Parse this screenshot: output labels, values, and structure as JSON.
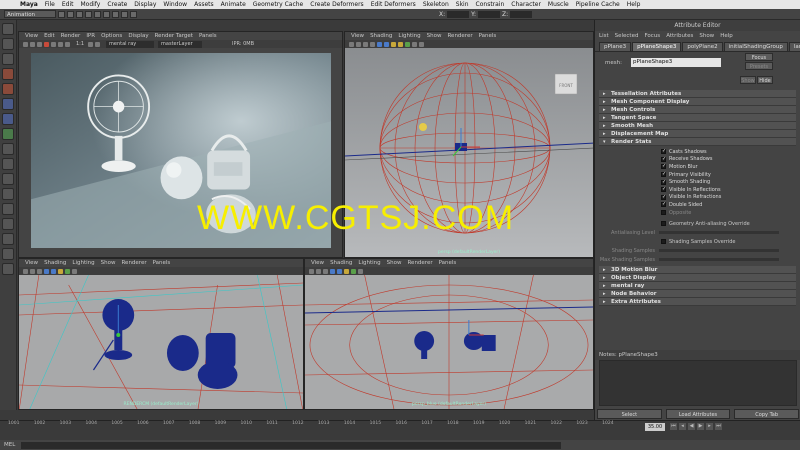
{
  "menubar": {
    "items": [
      "Maya",
      "File",
      "Edit",
      "Modify",
      "Create",
      "Display",
      "Window",
      "Assets",
      "Animate",
      "Geometry Cache",
      "Create Deformers",
      "Edit Deformers",
      "Skeleton",
      "Skin",
      "Constrain",
      "Character",
      "Muscle",
      "Pipeline Cache",
      "Help"
    ]
  },
  "status_line": {
    "mode": "Animation",
    "x_label": "X:",
    "y_label": "Y:",
    "z_label": "Z:"
  },
  "render_view": {
    "menu": [
      "View",
      "Edit",
      "Render",
      "IPR",
      "Options",
      "Display",
      "Render Target",
      "Panels"
    ],
    "ratio": "1:1",
    "renderer": "mental ray",
    "layer": "masterLayer",
    "ipr": "IPR: 0MB"
  },
  "persp_panel": {
    "menu": [
      "View",
      "Shading",
      "Lighting",
      "Show",
      "Renderer",
      "Panels"
    ],
    "label": "persp (defaultRenderLayer)",
    "cube_label": "FRONT"
  },
  "front_panel": {
    "menu": [
      "View",
      "Shading",
      "Lighting",
      "Show",
      "Renderer",
      "Panels"
    ],
    "label": "RENDERCM (defaultRenderLayer)"
  },
  "side_panel": {
    "menu": [
      "View",
      "Shading",
      "Lighting",
      "Show",
      "Renderer",
      "Panels"
    ],
    "label": "persp_blue (defaultRenderLayer)"
  },
  "attribute_editor": {
    "title": "Attribute Editor",
    "menu": [
      "List",
      "Selected",
      "Focus",
      "Attributes",
      "Show",
      "Help"
    ],
    "tabs": [
      "pPlane3",
      "pPlaneShape3",
      "polyPlane2",
      "initialShadingGroup",
      "lambert1"
    ],
    "mesh_label": "mesh:",
    "mesh_value": "pPlaneShape3",
    "focus_btn": "Focus",
    "presets_btn": "Presets",
    "show_btn": "Show",
    "hide_btn": "Hide",
    "sections_top": [
      "Tessellation Attributes",
      "Mesh Component Display",
      "Mesh Controls",
      "Tangent Space",
      "Smooth Mesh",
      "Displacement Map",
      "Render Stats"
    ],
    "render_stats": [
      {
        "label": "Casts Shadows",
        "checked": true
      },
      {
        "label": "Receive Shadows",
        "checked": true
      },
      {
        "label": "Motion Blur",
        "checked": true
      },
      {
        "label": "Primary Visibility",
        "checked": true
      },
      {
        "label": "Smooth Shading",
        "checked": true
      },
      {
        "label": "Visible In Reflections",
        "checked": true
      },
      {
        "label": "Visible In Refractions",
        "checked": true
      },
      {
        "label": "Double Sided",
        "checked": true
      },
      {
        "label": "Opposite",
        "checked": false
      }
    ],
    "geo_aa_label": "Geometry Anti-aliasing Override",
    "aa_level_label": "Antialiasing Level",
    "shading_override_label": "Shading Samples Override",
    "shading_samples_label": "Shading Samples",
    "max_shading_label": "Max Shading Samples",
    "sections_bottom": [
      "3D Motion Blur",
      "Object Display",
      "mental ray",
      "Node Behavior",
      "Extra Attributes"
    ],
    "notes_label": "Notes: pPlaneShape3",
    "buttons": [
      "Select",
      "Load Attributes",
      "Copy Tab"
    ]
  },
  "timeline": {
    "ticks": [
      "1001",
      "1002",
      "1003",
      "1004",
      "1005",
      "1006",
      "1007",
      "1008",
      "1009",
      "1010",
      "1011",
      "1012",
      "1013",
      "1014",
      "1015",
      "1016",
      "1017",
      "1018",
      "1019",
      "1020",
      "1021",
      "1022",
      "1023",
      "1024"
    ],
    "current": "35.00"
  },
  "command_line": {
    "label": "MEL"
  },
  "watermark": "WWW.CGTSJ.COM",
  "colors": {
    "watermark": "#f7ef00",
    "wire_red": "#c0392b",
    "mesh_blue": "#1a2a8a"
  }
}
